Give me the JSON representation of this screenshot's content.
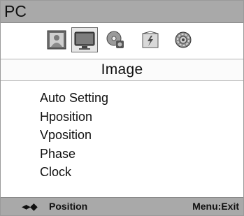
{
  "window": {
    "title": "PC"
  },
  "tabs": [
    {
      "icon": "picture-icon",
      "selected": false
    },
    {
      "icon": "screen-icon",
      "selected": true
    },
    {
      "icon": "audio-icon",
      "selected": false
    },
    {
      "icon": "clock-icon",
      "selected": false
    },
    {
      "icon": "gear-icon",
      "selected": false
    }
  ],
  "submenu": {
    "title": "Image"
  },
  "menu": {
    "items": [
      "Auto Setting",
      "Hposition",
      "Vposition",
      "Phase",
      "Clock"
    ]
  },
  "footer": {
    "nav_glyphs": "◂▸◆",
    "left_label": "Position",
    "right_label": "Menu:Exit"
  },
  "colors": {
    "bar_gray": "#a9a9a9",
    "background": "#ffffff",
    "text": "#111111"
  }
}
